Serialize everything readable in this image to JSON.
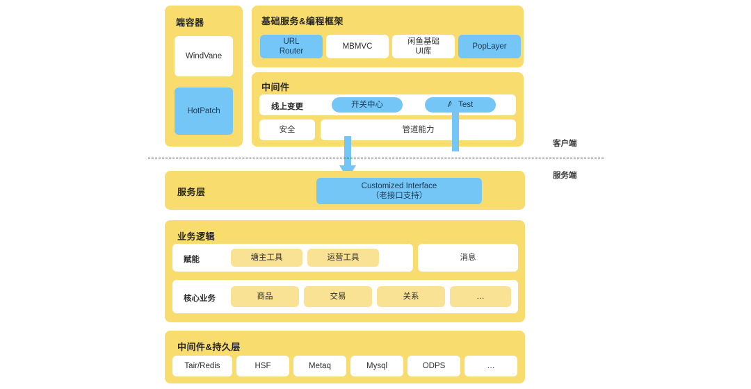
{
  "diagram": {
    "title_container": "端容器",
    "title_framework": "基础服务&编程框架",
    "title_middleware": "中间件",
    "title_service_layer": "服务层",
    "title_business_logic": "业务逻辑",
    "title_persistence": "中间件&持久层",
    "side_labels": {
      "client": "客户端",
      "server": "服务端"
    },
    "colors": {
      "panel_yellow": "#F8DC6E",
      "chip_blue": "#74C6F7",
      "chip_white": "#FFFFFF",
      "chip_light_yellow": "#F9E293",
      "arrow_blue": "#74C6F7",
      "divider": "#2f2f2f"
    },
    "container_items": [
      {
        "label": "WindVane",
        "style": "white"
      },
      {
        "label": "HotPatch",
        "style": "blue"
      }
    ],
    "framework_items": [
      {
        "label": "URL\nRouter",
        "style": "blue"
      },
      {
        "label": "MBMVC",
        "style": "white"
      },
      {
        "label": "闲鱼基础\nUI库",
        "style": "white"
      },
      {
        "label": "PopLayer",
        "style": "blue"
      }
    ],
    "middleware_row1": [
      {
        "label": "线上变更",
        "style": "plain"
      },
      {
        "label": "开关中心",
        "style": "blue"
      },
      {
        "label": "ABTest",
        "style": "blue"
      }
    ],
    "middleware_row2": [
      {
        "label": "安全",
        "style": "white"
      },
      {
        "label": "管道能力",
        "style": "white"
      }
    ],
    "service_layer_chip": {
      "line1": "Customized Interface",
      "line2": "（老接口支持）"
    },
    "business_row1": {
      "label": "赋能",
      "items": [
        {
          "label": "塘主工具",
          "style": "lyell"
        },
        {
          "label": "运营工具",
          "style": "lyell"
        }
      ],
      "separate_item": {
        "label": "消息",
        "style": "white"
      }
    },
    "business_row2": {
      "label": "核心业务",
      "items": [
        {
          "label": "商品",
          "style": "lyell"
        },
        {
          "label": "交易",
          "style": "lyell"
        },
        {
          "label": "关系",
          "style": "lyell"
        },
        {
          "label": "…",
          "style": "lyell"
        }
      ]
    },
    "persistence_items": [
      {
        "label": "Tair/Redis",
        "style": "white"
      },
      {
        "label": "HSF",
        "style": "white"
      },
      {
        "label": "Metaq",
        "style": "white"
      },
      {
        "label": "Mysql",
        "style": "white"
      },
      {
        "label": "ODPS",
        "style": "white"
      },
      {
        "label": "…",
        "style": "white"
      }
    ]
  }
}
